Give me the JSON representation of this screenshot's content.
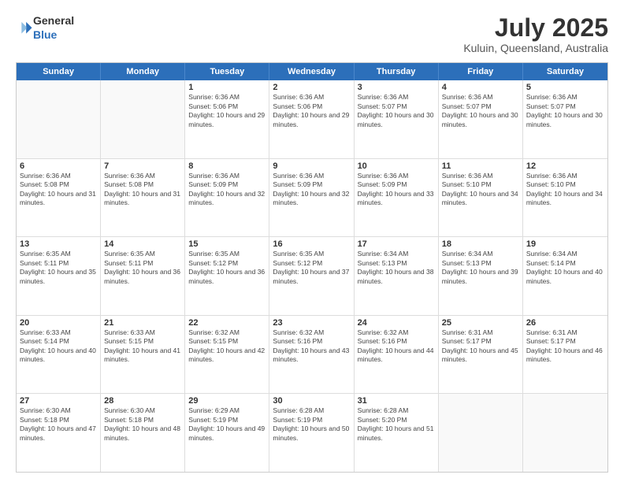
{
  "header": {
    "logo_general": "General",
    "logo_blue": "Blue",
    "title": "July 2025",
    "location": "Kuluin, Queensland, Australia"
  },
  "calendar": {
    "days_of_week": [
      "Sunday",
      "Monday",
      "Tuesday",
      "Wednesday",
      "Thursday",
      "Friday",
      "Saturday"
    ],
    "weeks": [
      [
        {
          "day": "",
          "sunrise": "",
          "sunset": "",
          "daylight": "",
          "empty": true
        },
        {
          "day": "",
          "sunrise": "",
          "sunset": "",
          "daylight": "",
          "empty": true
        },
        {
          "day": "1",
          "sunrise": "Sunrise: 6:36 AM",
          "sunset": "Sunset: 5:06 PM",
          "daylight": "Daylight: 10 hours and 29 minutes.",
          "empty": false
        },
        {
          "day": "2",
          "sunrise": "Sunrise: 6:36 AM",
          "sunset": "Sunset: 5:06 PM",
          "daylight": "Daylight: 10 hours and 29 minutes.",
          "empty": false
        },
        {
          "day": "3",
          "sunrise": "Sunrise: 6:36 AM",
          "sunset": "Sunset: 5:07 PM",
          "daylight": "Daylight: 10 hours and 30 minutes.",
          "empty": false
        },
        {
          "day": "4",
          "sunrise": "Sunrise: 6:36 AM",
          "sunset": "Sunset: 5:07 PM",
          "daylight": "Daylight: 10 hours and 30 minutes.",
          "empty": false
        },
        {
          "day": "5",
          "sunrise": "Sunrise: 6:36 AM",
          "sunset": "Sunset: 5:07 PM",
          "daylight": "Daylight: 10 hours and 30 minutes.",
          "empty": false
        }
      ],
      [
        {
          "day": "6",
          "sunrise": "Sunrise: 6:36 AM",
          "sunset": "Sunset: 5:08 PM",
          "daylight": "Daylight: 10 hours and 31 minutes.",
          "empty": false
        },
        {
          "day": "7",
          "sunrise": "Sunrise: 6:36 AM",
          "sunset": "Sunset: 5:08 PM",
          "daylight": "Daylight: 10 hours and 31 minutes.",
          "empty": false
        },
        {
          "day": "8",
          "sunrise": "Sunrise: 6:36 AM",
          "sunset": "Sunset: 5:09 PM",
          "daylight": "Daylight: 10 hours and 32 minutes.",
          "empty": false
        },
        {
          "day": "9",
          "sunrise": "Sunrise: 6:36 AM",
          "sunset": "Sunset: 5:09 PM",
          "daylight": "Daylight: 10 hours and 32 minutes.",
          "empty": false
        },
        {
          "day": "10",
          "sunrise": "Sunrise: 6:36 AM",
          "sunset": "Sunset: 5:09 PM",
          "daylight": "Daylight: 10 hours and 33 minutes.",
          "empty": false
        },
        {
          "day": "11",
          "sunrise": "Sunrise: 6:36 AM",
          "sunset": "Sunset: 5:10 PM",
          "daylight": "Daylight: 10 hours and 34 minutes.",
          "empty": false
        },
        {
          "day": "12",
          "sunrise": "Sunrise: 6:36 AM",
          "sunset": "Sunset: 5:10 PM",
          "daylight": "Daylight: 10 hours and 34 minutes.",
          "empty": false
        }
      ],
      [
        {
          "day": "13",
          "sunrise": "Sunrise: 6:35 AM",
          "sunset": "Sunset: 5:11 PM",
          "daylight": "Daylight: 10 hours and 35 minutes.",
          "empty": false
        },
        {
          "day": "14",
          "sunrise": "Sunrise: 6:35 AM",
          "sunset": "Sunset: 5:11 PM",
          "daylight": "Daylight: 10 hours and 36 minutes.",
          "empty": false
        },
        {
          "day": "15",
          "sunrise": "Sunrise: 6:35 AM",
          "sunset": "Sunset: 5:12 PM",
          "daylight": "Daylight: 10 hours and 36 minutes.",
          "empty": false
        },
        {
          "day": "16",
          "sunrise": "Sunrise: 6:35 AM",
          "sunset": "Sunset: 5:12 PM",
          "daylight": "Daylight: 10 hours and 37 minutes.",
          "empty": false
        },
        {
          "day": "17",
          "sunrise": "Sunrise: 6:34 AM",
          "sunset": "Sunset: 5:13 PM",
          "daylight": "Daylight: 10 hours and 38 minutes.",
          "empty": false
        },
        {
          "day": "18",
          "sunrise": "Sunrise: 6:34 AM",
          "sunset": "Sunset: 5:13 PM",
          "daylight": "Daylight: 10 hours and 39 minutes.",
          "empty": false
        },
        {
          "day": "19",
          "sunrise": "Sunrise: 6:34 AM",
          "sunset": "Sunset: 5:14 PM",
          "daylight": "Daylight: 10 hours and 40 minutes.",
          "empty": false
        }
      ],
      [
        {
          "day": "20",
          "sunrise": "Sunrise: 6:33 AM",
          "sunset": "Sunset: 5:14 PM",
          "daylight": "Daylight: 10 hours and 40 minutes.",
          "empty": false
        },
        {
          "day": "21",
          "sunrise": "Sunrise: 6:33 AM",
          "sunset": "Sunset: 5:15 PM",
          "daylight": "Daylight: 10 hours and 41 minutes.",
          "empty": false
        },
        {
          "day": "22",
          "sunrise": "Sunrise: 6:32 AM",
          "sunset": "Sunset: 5:15 PM",
          "daylight": "Daylight: 10 hours and 42 minutes.",
          "empty": false
        },
        {
          "day": "23",
          "sunrise": "Sunrise: 6:32 AM",
          "sunset": "Sunset: 5:16 PM",
          "daylight": "Daylight: 10 hours and 43 minutes.",
          "empty": false
        },
        {
          "day": "24",
          "sunrise": "Sunrise: 6:32 AM",
          "sunset": "Sunset: 5:16 PM",
          "daylight": "Daylight: 10 hours and 44 minutes.",
          "empty": false
        },
        {
          "day": "25",
          "sunrise": "Sunrise: 6:31 AM",
          "sunset": "Sunset: 5:17 PM",
          "daylight": "Daylight: 10 hours and 45 minutes.",
          "empty": false
        },
        {
          "day": "26",
          "sunrise": "Sunrise: 6:31 AM",
          "sunset": "Sunset: 5:17 PM",
          "daylight": "Daylight: 10 hours and 46 minutes.",
          "empty": false
        }
      ],
      [
        {
          "day": "27",
          "sunrise": "Sunrise: 6:30 AM",
          "sunset": "Sunset: 5:18 PM",
          "daylight": "Daylight: 10 hours and 47 minutes.",
          "empty": false
        },
        {
          "day": "28",
          "sunrise": "Sunrise: 6:30 AM",
          "sunset": "Sunset: 5:18 PM",
          "daylight": "Daylight: 10 hours and 48 minutes.",
          "empty": false
        },
        {
          "day": "29",
          "sunrise": "Sunrise: 6:29 AM",
          "sunset": "Sunset: 5:19 PM",
          "daylight": "Daylight: 10 hours and 49 minutes.",
          "empty": false
        },
        {
          "day": "30",
          "sunrise": "Sunrise: 6:28 AM",
          "sunset": "Sunset: 5:19 PM",
          "daylight": "Daylight: 10 hours and 50 minutes.",
          "empty": false
        },
        {
          "day": "31",
          "sunrise": "Sunrise: 6:28 AM",
          "sunset": "Sunset: 5:20 PM",
          "daylight": "Daylight: 10 hours and 51 minutes.",
          "empty": false
        },
        {
          "day": "",
          "sunrise": "",
          "sunset": "",
          "daylight": "",
          "empty": true
        },
        {
          "day": "",
          "sunrise": "",
          "sunset": "",
          "daylight": "",
          "empty": true
        }
      ]
    ]
  }
}
